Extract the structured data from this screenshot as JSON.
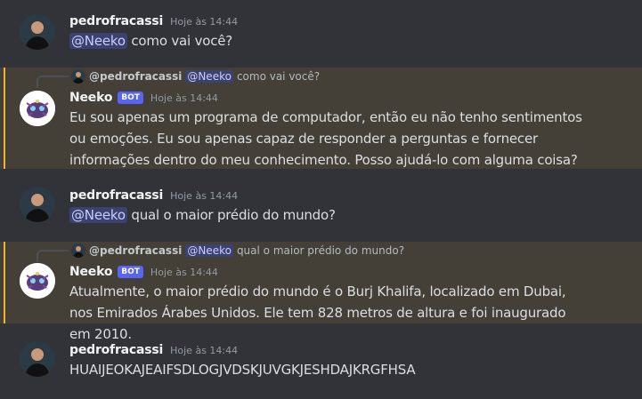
{
  "messages": [
    {
      "author": "pedrofracassi",
      "timestamp": "Hoje às 14:44",
      "mention": "@Neeko",
      "text": " como vai você?"
    },
    {
      "author": "Neeko",
      "badge": "BOT",
      "timestamp": "Hoje às 14:44",
      "reply": {
        "author": "@pedrofracassi",
        "mention": "@Neeko",
        "text": "como vai você?"
      },
      "text": "Eu sou apenas um programa de computador, então eu não tenho sentimentos ou emoções. Eu sou apenas capaz de responder a perguntas e fornecer informações dentro do meu conhecimento. Posso ajudá-lo com alguma coisa?"
    },
    {
      "author": "pedrofracassi",
      "timestamp": "Hoje às 14:44",
      "mention": "@Neeko",
      "text": " qual o maior prédio do mundo?"
    },
    {
      "author": "Neeko",
      "badge": "BOT",
      "timestamp": "Hoje às 14:44",
      "reply": {
        "author": "@pedrofracassi",
        "mention": "@Neeko",
        "text": "qual o maior prédio do mundo?"
      },
      "text": "Atualmente, o maior prédio do mundo é o Burj Khalifa, localizado em Dubai, nos Emirados Árabes Unidos. Ele tem 828 metros de altura e foi inaugurado em 2010."
    },
    {
      "author": "pedrofracassi",
      "timestamp": "Hoje às 14:44",
      "text": "HUAIJEOKAJEAIFSDLOGJVDSKJUVGKJESHDAJKRGFHSA"
    }
  ],
  "colors": {
    "background": "#313338",
    "highlight": "#444037",
    "highlight_bar": "#f0b232",
    "mention_bg": "#3c4270",
    "bot_badge": "#5865f2"
  }
}
